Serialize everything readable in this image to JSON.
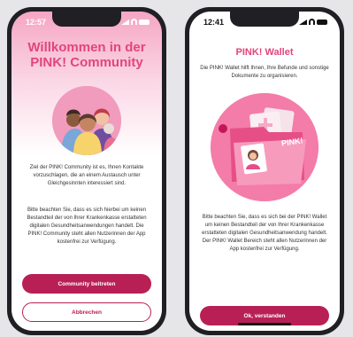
{
  "left": {
    "status_time": "12:57",
    "title_line1": "Willkommen in der",
    "title_line2": "PINK! Community",
    "paragraph1": "Ziel der PINK! Community ist es, Ihnen Kontakte vorzuschlagen, die an einem Austausch unter Gleichgesinnten interessiert sind.",
    "paragraph2": "Bitte beachten Sie, dass es sich hierbei um keinen Bestandteil der von Ihrer Krankenkasse erstatteten digitalen Gesundheitsanwendungen handelt. Die PINK! Community steht allen Nutzerinnen der App kostenfrei zur Verfügung.",
    "join_button": "Community beitreten",
    "cancel_button": "Abbrechen"
  },
  "right": {
    "status_time": "12:41",
    "title": "PINK! Wallet",
    "subtitle": "Die PINK! Wallet hilft Ihnen, Ihre Befunde und sonstige Dokumente zu organisieren.",
    "card_label": "PINK!",
    "paragraph": "Bitte beachten Sie, dass es sich bei der PINK! Wallet um keinen Bestandteil der von Ihrer Krankenkasse erstatteten digitalen Gesundheitsanwendung handelt. Der PINK! Wallet Bereich steht allen Nutzerinnen der App kostenfrei zur Verfügung.",
    "ok_button": "Ok, verstanden"
  },
  "colors": {
    "accent": "#e2457d",
    "button": "#b82055",
    "illustration_pink": "#f47ca9"
  }
}
